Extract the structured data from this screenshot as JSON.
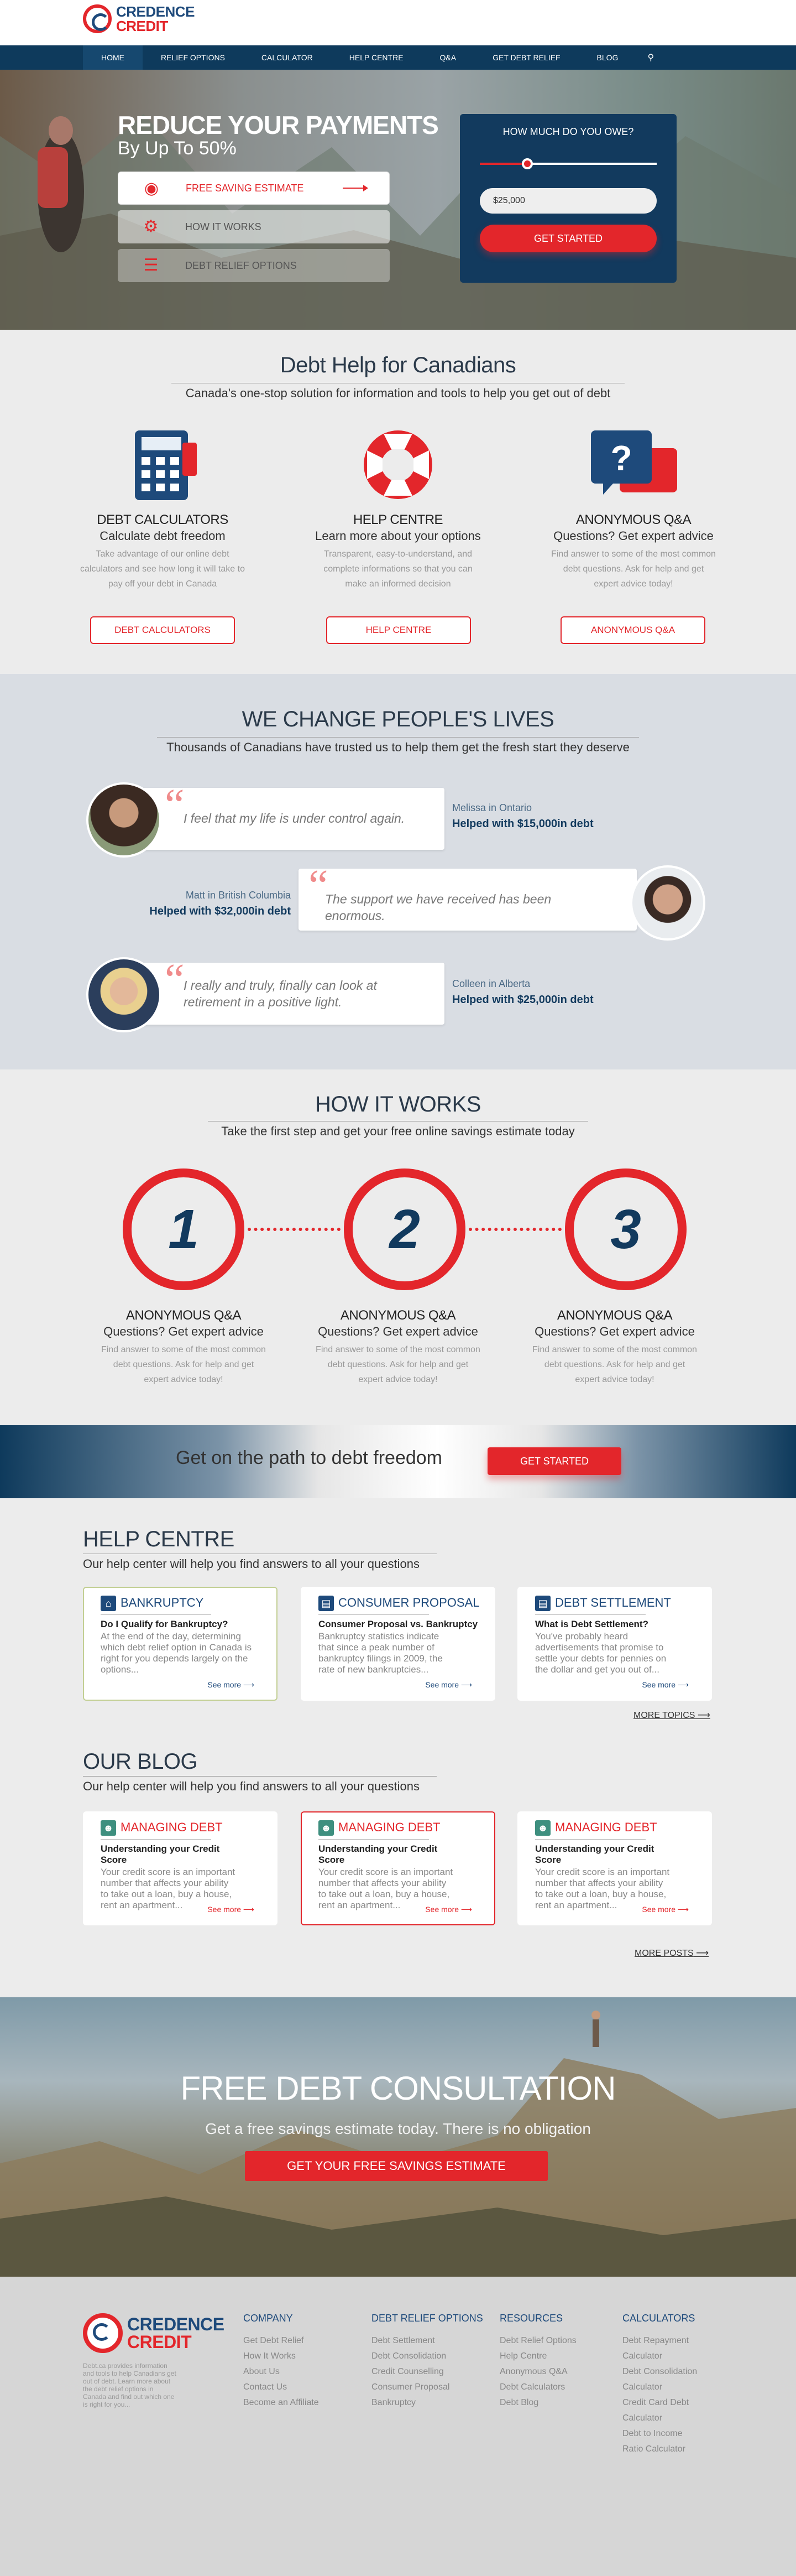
{
  "header": {
    "logo_line1": "CREDENCE",
    "logo_line2": "CREDIT",
    "nav": [
      "HOME",
      "RELIEF OPTIONS",
      "CALCULATOR",
      "HELP CENTRE",
      "Q&A",
      "GET DEBT RELIEF",
      "BLOG"
    ],
    "search_icon": "search-icon"
  },
  "hero": {
    "title": "REDUCE YOUR PAYMENTS",
    "subtitle": "By Up To 50%",
    "buttons": [
      "FREE SAVING ESTIMATE",
      "HOW IT WORKS",
      "DEBT RELIEF OPTIONS"
    ],
    "owe_title": "HOW MUCH DO YOU OWE?",
    "owe_value": "$25,000",
    "owe_slider_fraction": 0.27,
    "owe_button": "GET STARTED"
  },
  "help": {
    "title": "Debt Help for Canadians",
    "subtitle": "Canada's one-stop solution for information and tools to help you get out of debt",
    "columns": [
      {
        "title": "DEBT CALCULATORS",
        "sub": "Calculate debt freedom",
        "desc": "Take advantage of our online debt calculators and see how long it will take to pay off your debt in Canada",
        "button": "DEBT CALCULATORS",
        "icon": "calculator-icon"
      },
      {
        "title": "HELP CENTRE",
        "sub": "Learn more about your options",
        "desc": "Transparent, easy-to-understand, and complete informations so that you can make an informed decision",
        "button": "HELP CENTRE",
        "icon": "lifebuoy-icon"
      },
      {
        "title": "ANONYMOUS Q&A",
        "sub": "Questions? Get expert advice",
        "desc": "Find answer to some of the most common debt questions. Ask for help and get expert advice today!",
        "button": "ANONYMOUS Q&A",
        "icon": "question-bubble-icon"
      }
    ]
  },
  "testimonials": {
    "title": "WE CHANGE PEOPLE'S LIVES",
    "subtitle": "Thousands of Canadians have trusted us to help them get the fresh start they deserve",
    "items": [
      {
        "quote": "I feel that my life is under control again.",
        "name": "Melissa in Ontario",
        "debt": "Helped with $15,000in debt"
      },
      {
        "quote": "The support we have received has been enormous.",
        "name": "Matt in British Columbia",
        "debt": "Helped with $32,000in debt"
      },
      {
        "quote": "I really and truly, finally can look at retirement in a positive light.",
        "name": "Colleen in Alberta",
        "debt": "Helped with $25,000in debt"
      }
    ]
  },
  "how": {
    "title": "HOW IT WORKS",
    "subtitle": "Take the first step and get your free online savings estimate today",
    "steps": [
      {
        "num": "1",
        "title": "ANONYMOUS Q&A",
        "sub": "Questions? Get expert advice",
        "desc": "Find answer to some of the most common debt questions. Ask for help and get expert advice today!"
      },
      {
        "num": "2",
        "title": "ANONYMOUS Q&A",
        "sub": "Questions? Get expert advice",
        "desc": "Find answer to some of the most common debt questions. Ask for help and get expert advice today!"
      },
      {
        "num": "3",
        "title": "ANONYMOUS Q&A",
        "sub": "Questions? Get expert advice",
        "desc": "Find answer to some of the most common debt questions. Ask for help and get expert advice today!"
      }
    ]
  },
  "banner": {
    "text": "Get on the path to debt freedom",
    "button": "GET STARTED"
  },
  "helpcentre": {
    "title": "HELP CENTRE",
    "subtitle": "Our help center will help you find answers to all your questions",
    "cards": [
      {
        "tag": "BANKRUPTCY",
        "q": "Do I Qualify for Bankruptcy?",
        "t": "At the end of the day, determining which debt relief option in Canada is right for you depends largely on the options...",
        "more": "See more"
      },
      {
        "tag": "CONSUMER PROPOSAL",
        "q": "Consumer Proposal vs. Bankruptcy",
        "t": "Bankruptcy statistics indicate that since a peak number of bankruptcy filings in 2009, the rate of new bankruptcies...",
        "more": "See more"
      },
      {
        "tag": "DEBT SETTLEMENT",
        "q": "What is Debt Settlement?",
        "t": "You've probably heard advertisements that promise to settle your debts for pennies on the dollar and get you out of...",
        "more": "See more"
      }
    ],
    "more": "MORE TOPICS"
  },
  "blog": {
    "title": "OUR BLOG",
    "subtitle": "Our help center will help you find answers to all your questions",
    "cards": [
      {
        "tag": "MANAGING DEBT",
        "q": "Understanding your Credit Score",
        "t": "Your credit score is an important number that affects your ability to take out a loan, buy a house, rent an apartment...",
        "more": "See more"
      },
      {
        "tag": "MANAGING DEBT",
        "q": "Understanding your Credit Score",
        "t": "Your credit score is an important number that affects your ability to take out a loan, buy a house, rent an apartment...",
        "more": "See more"
      },
      {
        "tag": "MANAGING DEBT",
        "q": "Understanding your Credit Score",
        "t": "Your credit score is an important number that affects your ability to take out a loan, buy a house, rent an apartment...",
        "more": "See more"
      }
    ],
    "more": "MORE POSTS"
  },
  "consult": {
    "title": "FREE DEBT CONSULTATION",
    "subtitle": "Get a free savings estimate today. There is no obligation",
    "button": "GET  YOUR FREE SAVINGS ESTIMATE"
  },
  "footer": {
    "logo_line1": "CREDENCE",
    "logo_line2": "CREDIT",
    "desc": "Debt.ca provides information and tools to help Canadians get out of debt. Learn more about the debt relief options in Canada and find out which one is right for you...",
    "columns": [
      {
        "title": "COMPANY",
        "items": [
          "Get Debt Relief",
          "How It Works",
          "About Us",
          "Contact Us",
          "Become an Affiliate"
        ]
      },
      {
        "title": "DEBT RELIEF OPTIONS",
        "items": [
          "Debt Settlement",
          "Debt Consolidation",
          "Credit Counselling",
          "Consumer Proposal",
          "Bankruptcy"
        ]
      },
      {
        "title": "RESOURCES",
        "items": [
          "Debt Relief Options",
          "Help Centre",
          "Anonymous Q&A",
          "Debt Calculators",
          "Debt Blog"
        ]
      },
      {
        "title": "CALCULATORS",
        "items": [
          "Debt Repayment Calculator",
          "Debt Consolidation Calculator",
          "Credit Card Debt Calculator",
          "Debt to Income Ratio Calculator"
        ]
      }
    ]
  },
  "colors": {
    "brand_red": "#e3262b",
    "brand_navy": "#0e3a5c"
  }
}
